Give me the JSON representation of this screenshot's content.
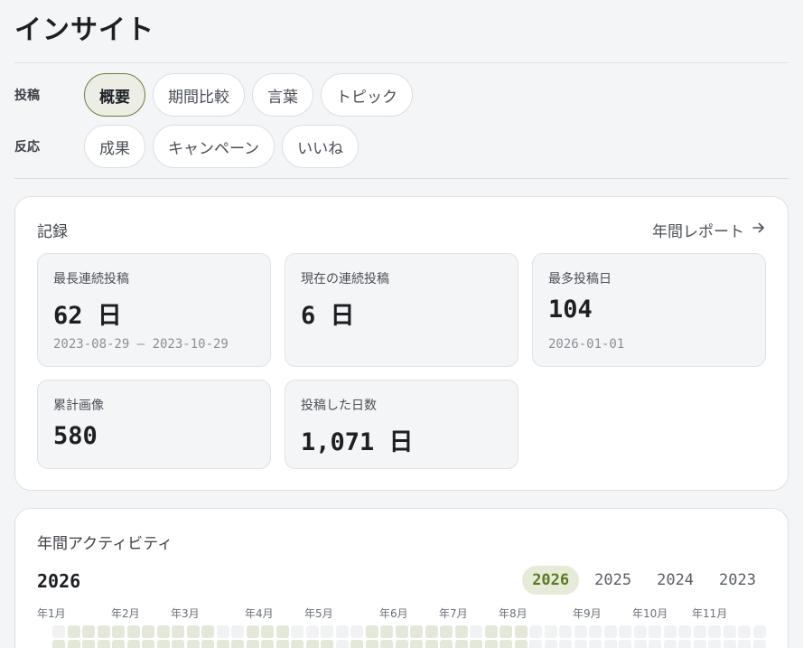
{
  "page": {
    "title": "インサイト"
  },
  "filters": {
    "rows": [
      {
        "label": "投稿",
        "chips": [
          {
            "label": "概要",
            "active": true
          },
          {
            "label": "期間比較",
            "active": false
          },
          {
            "label": "言葉",
            "active": false
          },
          {
            "label": "トピック",
            "active": false
          }
        ]
      },
      {
        "label": "反応",
        "chips": [
          {
            "label": "成果",
            "active": false
          },
          {
            "label": "キャンペーン",
            "active": false
          },
          {
            "label": "いいね",
            "active": false
          }
        ]
      }
    ]
  },
  "records": {
    "title": "記録",
    "report_link": "年間レポート",
    "report_icon": "arrow-right-icon",
    "stats": [
      {
        "label": "最長連続投稿",
        "value": "62 日",
        "sub": "2023-08-29 – 2023-10-29"
      },
      {
        "label": "現在の連続投稿",
        "value": "6 日",
        "sub": ""
      },
      {
        "label": "最多投稿日",
        "value": "104",
        "sub": "2026-01-01"
      },
      {
        "label": "累計画像",
        "value": "580",
        "sub": ""
      },
      {
        "label": "投稿した日数",
        "value": "1,071 日",
        "sub": ""
      }
    ]
  },
  "activity": {
    "title": "年間アクティビティ",
    "selected_year": "2026",
    "years": [
      {
        "label": "2026",
        "active": true
      },
      {
        "label": "2025",
        "active": false
      },
      {
        "label": "2024",
        "active": false
      },
      {
        "label": "2023",
        "active": false
      }
    ],
    "months": [
      "年1月",
      "年2月",
      "年3月",
      "年4月",
      "年5月",
      "年6月",
      "年7月",
      "年8月",
      "年9月",
      "年10月",
      "年11月"
    ],
    "colors": {
      "active": "#e4e8d8",
      "empty": "#f1f2f4",
      "accent": "#5f7a25"
    },
    "weeks": [
      [
        0,
        1
      ],
      [
        1,
        1
      ],
      [
        1,
        1
      ],
      [
        1,
        1
      ],
      [
        1,
        1
      ],
      [
        1,
        1
      ],
      [
        1,
        1
      ],
      [
        1,
        1
      ],
      [
        1,
        1
      ],
      [
        1,
        1
      ],
      [
        1,
        1
      ],
      [
        0,
        1
      ],
      [
        0,
        1
      ],
      [
        1,
        1
      ],
      [
        1,
        1
      ],
      [
        1,
        1
      ],
      [
        0,
        1
      ],
      [
        0,
        1
      ],
      [
        0,
        1
      ],
      [
        0,
        0
      ],
      [
        0,
        1
      ],
      [
        1,
        1
      ],
      [
        1,
        1
      ],
      [
        1,
        1
      ],
      [
        1,
        1
      ],
      [
        1,
        1
      ],
      [
        1,
        1
      ],
      [
        1,
        1
      ],
      [
        0,
        1
      ],
      [
        1,
        1
      ],
      [
        1,
        1
      ],
      [
        1,
        1
      ],
      [
        0,
        0
      ],
      [
        0,
        0
      ],
      [
        0,
        0
      ],
      [
        0,
        0
      ],
      [
        0,
        0
      ],
      [
        0,
        0
      ],
      [
        0,
        0
      ],
      [
        0,
        0
      ],
      [
        0,
        0
      ],
      [
        0,
        0
      ],
      [
        0,
        0
      ],
      [
        0,
        0
      ],
      [
        0,
        0
      ],
      [
        0,
        0
      ],
      [
        0,
        0
      ],
      [
        0,
        0
      ]
    ]
  }
}
